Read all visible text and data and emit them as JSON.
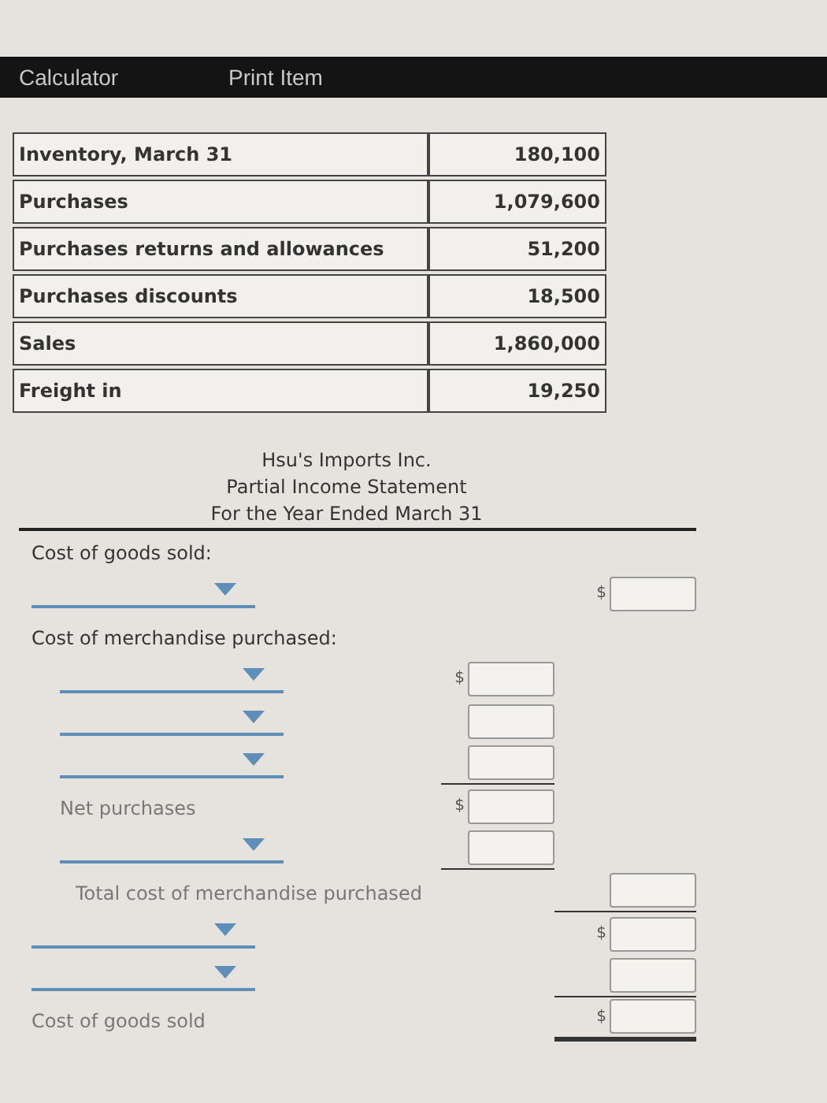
{
  "toolbar": {
    "items": [
      {
        "label": "Calculator"
      },
      {
        "label": "Print Item"
      }
    ]
  },
  "data_table": {
    "rows": [
      {
        "label": "Inventory, March 31",
        "value": "180,100"
      },
      {
        "label": "Purchases",
        "value": "1,079,600"
      },
      {
        "label": "Purchases returns and allowances",
        "value": "51,200"
      },
      {
        "label": "Purchases discounts",
        "value": "18,500"
      },
      {
        "label": "Sales",
        "value": "1,860,000"
      },
      {
        "label": "Freight in",
        "value": "19,250"
      }
    ]
  },
  "statement": {
    "heading": [
      "Hsu's Imports Inc.",
      "Partial Income Statement",
      "For the Year Ended March 31"
    ],
    "lines": [
      {
        "kind": "label",
        "text": "Cost of goods sold:"
      },
      {
        "kind": "select",
        "amount": {
          "kind": "outer",
          "currency": "$"
        }
      },
      {
        "kind": "label",
        "text": "Cost of merchandise purchased:",
        "children": [
          {
            "kind": "select",
            "amount": {
              "kind": "inner",
              "currency": "$"
            }
          },
          {
            "kind": "select",
            "amount": {
              "kind": "inner"
            }
          },
          {
            "kind": "select",
            "amount": {
              "kind": "inner",
              "underlined": true
            }
          },
          {
            "kind": "label",
            "text": "Net purchases",
            "amount": {
              "kind": "inner",
              "currency": "$"
            }
          },
          {
            "kind": "select",
            "amount": {
              "kind": "inner",
              "underlined": true
            }
          },
          {
            "kind": "total",
            "text": "Total cost of merchandise purchased",
            "amount": {
              "kind": "outer",
              "underlined": true
            }
          }
        ]
      },
      {
        "kind": "select",
        "amount": {
          "kind": "outer",
          "currency": "$"
        }
      },
      {
        "kind": "select",
        "amount": {
          "kind": "outer",
          "underlined": true
        }
      },
      {
        "kind": "label",
        "text": "Cost of goods sold",
        "amount": {
          "kind": "outer",
          "currency": "$",
          "double_underlined": true
        }
      }
    ]
  }
}
